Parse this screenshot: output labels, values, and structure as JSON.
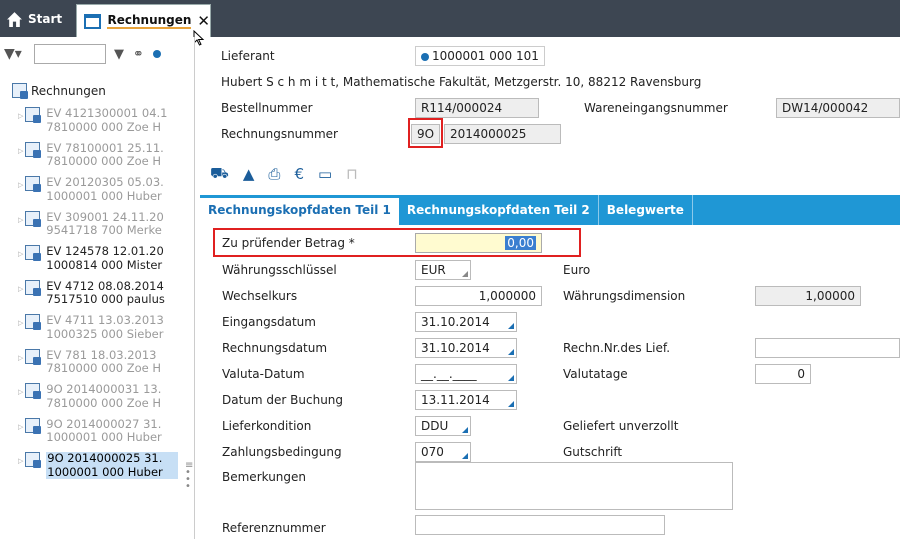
{
  "tabs": {
    "start_label": "Start",
    "active_label": "Rechnungen",
    "close_symbol": "✕"
  },
  "sidebar": {
    "root_label": "Rechnungen",
    "items": [
      {
        "line1": "EV 4121300001 04.1",
        "line2": "7810000 000 Zoe H",
        "state": "dim"
      },
      {
        "line1": "EV 78100001 25.11.",
        "line2": "7810000 000 Zoe H",
        "state": "dim"
      },
      {
        "line1": "EV 20120305 05.03.",
        "line2": "1000001 000 Huber",
        "state": "dim"
      },
      {
        "line1": "EV 309001 24.11.20",
        "line2": "9541718 700 Merke",
        "state": "dim"
      },
      {
        "line1": "EV 124578 12.01.20",
        "line2": "1000814 000 Mister",
        "state": "normal"
      },
      {
        "line1": "EV 4712 08.08.2014",
        "line2": "7517510 000 paulus",
        "state": "normal"
      },
      {
        "line1": "EV 4711 13.03.2013",
        "line2": "1000325 000 Sieber",
        "state": "dim"
      },
      {
        "line1": "EV 781 18.03.2013",
        "line2": "7810000 000 Zoe H",
        "state": "dim"
      },
      {
        "line1": "9O 2014000031 13.",
        "line2": "7810000 000 Zoe H",
        "state": "dim"
      },
      {
        "line1": "9O 2014000027 31.",
        "line2": "1000001 000 Huber",
        "state": "dim"
      },
      {
        "line1": "9O 2014000025 31.",
        "line2": "1000001 000 Huber",
        "state": "selected"
      }
    ]
  },
  "header": {
    "lieferant_label": "Lieferant",
    "lieferant_value": "1000001 000 101",
    "address": "Hubert S c h m i t t, Mathematische Fakultät, Metzgerstr. 10, 88212 Ravensburg",
    "bestellnummer_label": "Bestellnummer",
    "bestellnummer_value": "R114/000024",
    "wareneingang_label": "Wareneingangsnummer",
    "wareneingang_value": "DW14/000042",
    "rechnungsnummer_label": "Rechnungsnummer",
    "rechnungsnummer_prefix": "9O",
    "rechnungsnummer_value": "2014000025"
  },
  "content_tabs": [
    "Rechnungskopfdaten Teil 1",
    "Rechnungskopfdaten Teil 2",
    "Belegwerte"
  ],
  "form": {
    "betrag_label": "Zu prüfender Betrag *",
    "betrag_value": "0,00",
    "waehrung_label": "Währungsschlüssel",
    "waehrung_value": "EUR",
    "waehrung_text": "Euro",
    "kurs_label": "Wechselkurs",
    "kurs_value": "1,000000",
    "dimension_label": "Währungsdimension",
    "dimension_value": "1,00000",
    "eingang_label": "Eingangsdatum",
    "eingang_value": "31.10.2014",
    "rdatum_label": "Rechnungsdatum",
    "rdatum_value": "31.10.2014",
    "rnr_lief_label": "Rechn.Nr.des Lief.",
    "rnr_lief_value": "",
    "valuta_label": "Valuta-Datum",
    "valuta_value": "__.__.____",
    "valutatage_label": "Valutatage",
    "valutatage_value": "0",
    "buchung_label": "Datum der Buchung",
    "buchung_value": "13.11.2014",
    "lieferkond_label": "Lieferkondition",
    "lieferkond_value": "DDU",
    "lieferkond_text": "Geliefert unverzollt",
    "zahlung_label": "Zahlungsbedingung",
    "zahlung_value": "070",
    "zahlung_text": "Gutschrift",
    "bemerkungen_label": "Bemerkungen",
    "referenz_label": "Referenznummer"
  },
  "colors": {
    "accent": "#1f97d5",
    "highlight": "#e02020",
    "selected_bg": "#c7dff5"
  }
}
